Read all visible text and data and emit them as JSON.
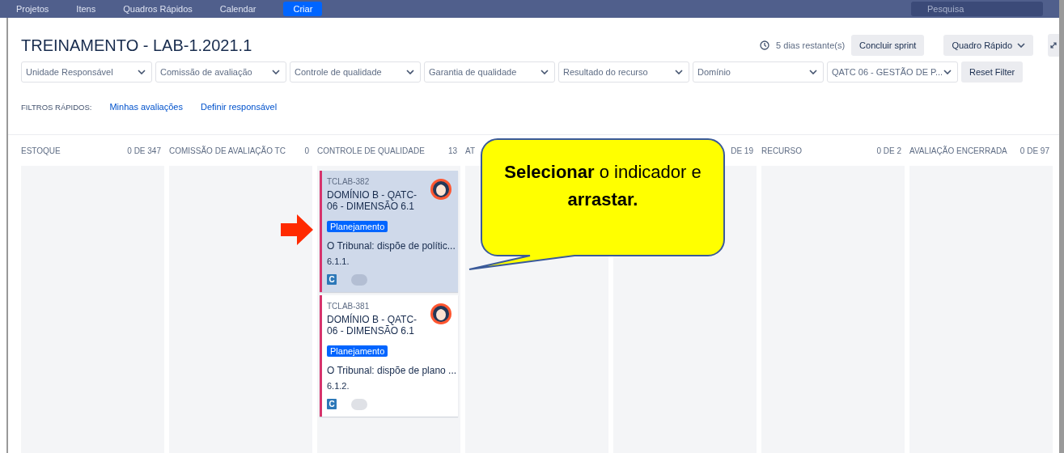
{
  "nav": {
    "items": [
      "Projetos",
      "Itens",
      "Quadros Rápidos",
      "Calendar"
    ],
    "create": "Criar",
    "search": {
      "placeholder": "Pesquisa"
    }
  },
  "board": {
    "title": "TREINAMENTO - LAB-1.2021.1",
    "remaining": "5 dias restante(s)",
    "complete_button": "Concluir sprint",
    "board_button": "Quadro Rápido",
    "filters": [
      "Unidade Responsável",
      "Comissão de avaliação",
      "Controle de qualidade",
      "Garantia de qualidade",
      "Resultado do recurso",
      "Domínio",
      "QATC 06 - GESTÃO DE P..."
    ],
    "reset_button": "Reset Filter",
    "quick_filters_label": "FILTROS RÁPIDOS:",
    "quick_filters": [
      "Minhas avaliações",
      "Definir responsável"
    ]
  },
  "columns": [
    {
      "name": "ESTOQUE",
      "count": "0 DE 347"
    },
    {
      "name": "COMISSÃO DE AVALIAÇÃO TC",
      "count": "0"
    },
    {
      "name": "CONTROLE DE QUALIDADE",
      "count": "13",
      "cards": [
        {
          "key": "TCLAB-382",
          "title": "DOMÍNIO B - QATC-06 - DIMENSÃO 6.1",
          "label": "Planejamento",
          "summary": "O Tribunal: dispõe de polític...",
          "code": "6.1.1.",
          "type_badge": "C",
          "selected": true
        },
        {
          "key": "TCLAB-381",
          "title": "DOMÍNIO B - QATC-06 - DIMENSÃO 6.1",
          "label": "Planejamento",
          "summary": "O Tribunal: dispõe de plano ...",
          "code": "6.1.2.",
          "type_badge": "C",
          "selected": false
        }
      ]
    },
    {
      "name": "AT"
    },
    {
      "count": "DE 19"
    },
    {
      "name": "RECURSO",
      "count": "0 DE 2"
    },
    {
      "name": "AVALIAÇÃO ENCERRADA",
      "count": "0 DE 97"
    }
  ],
  "callout": {
    "text": "**Selecionar** o indicador e **arrastar.**"
  }
}
